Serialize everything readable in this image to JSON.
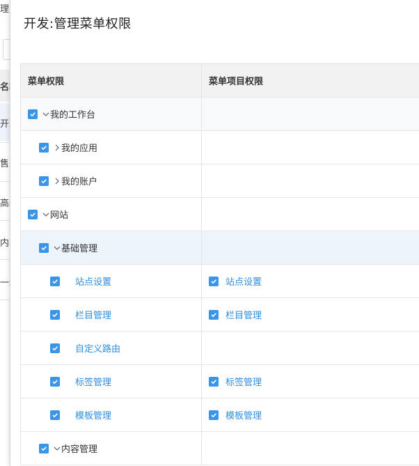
{
  "background": {
    "fragments": [
      "理",
      "名称",
      "开发",
      "售后",
      "高级",
      "内容",
      "一级"
    ]
  },
  "dialog": {
    "title": "开发:管理菜单权限"
  },
  "table": {
    "headers": [
      "菜单权限",
      "菜单项目权限"
    ],
    "rows": [
      {
        "label": "我的工作台",
        "expanded": true,
        "checked": true
      },
      {
        "label": "我的应用",
        "expanded": false,
        "checked": true
      },
      {
        "label": "我的账户",
        "expanded": false,
        "checked": true
      },
      {
        "label": "网站",
        "expanded": true,
        "checked": true
      },
      {
        "label": "基础管理",
        "expanded": true,
        "checked": true
      },
      {
        "label": "站点设置",
        "checked": true,
        "item": "站点设置",
        "item_checked": true
      },
      {
        "label": "栏目管理",
        "checked": true,
        "item": "栏目管理",
        "item_checked": true
      },
      {
        "label": "自定义路由",
        "checked": true
      },
      {
        "label": "标签管理",
        "checked": true,
        "item": "标签管理",
        "item_checked": true
      },
      {
        "label": "模板管理",
        "checked": true,
        "item": "模板管理",
        "item_checked": true
      },
      {
        "label": "内容管理",
        "expanded": true,
        "checked": true
      }
    ]
  },
  "colors": {
    "accent": "#3b95e6",
    "link": "#2d8ee0",
    "header_bg": "#f2f2f2",
    "selected_row_bg": "#eef4fc"
  },
  "icons": {
    "check": "check-icon",
    "expand": "chevron-down-icon",
    "collapse": "chevron-right-icon"
  }
}
